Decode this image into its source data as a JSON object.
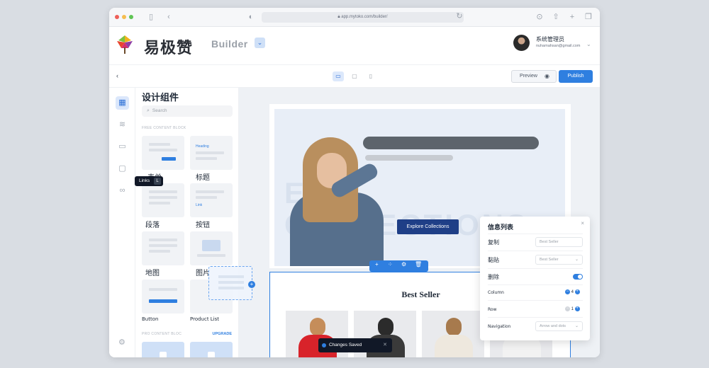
{
  "browser": {
    "url": "app.mytoko.com/builder/",
    "traffic_colors": [
      "#ee5f58",
      "#f5bd4f",
      "#5fc454"
    ]
  },
  "header": {
    "brand": "易极赞",
    "builder": "Builder",
    "user_name": "系统管理员",
    "user_email": "nuhamahsan@gmail.com"
  },
  "toolbar": {
    "preview_label": "Preview",
    "publish_label": "Publish"
  },
  "rail": {
    "tooltip_label": "Links",
    "tooltip_key": "L"
  },
  "panel": {
    "title": "设计组件",
    "search_placeholder": "Search",
    "free_label": "FREE CONTENT BLOCK",
    "pro_label": "PRO CONTENT BLOC",
    "upgrade_label": "UPGRADE",
    "tiles": [
      {
        "label": "表单",
        "thumb_text": ""
      },
      {
        "label": "标题",
        "thumb_text": "Heading"
      },
      {
        "label": "段落",
        "thumb_text": ""
      },
      {
        "label": "按钮",
        "thumb_text": "Link"
      },
      {
        "label": "地图",
        "thumb_text": ""
      },
      {
        "label": "图片",
        "thumb_text": ""
      },
      {
        "label": "Button",
        "thumb_text": ""
      },
      {
        "label": "Product List",
        "thumb_text": ""
      }
    ]
  },
  "canvas": {
    "hero_faint_1": "EXPL",
    "hero_faint_2": "COLLECTIONS",
    "explore_label": "Explore Collections",
    "bestseller_title": "Best Seller",
    "accent": "#2f7fe0"
  },
  "info_panel": {
    "title": "信息列表",
    "rows": [
      {
        "label": "复制",
        "value": "Best Seller"
      },
      {
        "label": "黏贴",
        "value": "Best Seller"
      },
      {
        "label": "删除",
        "value": ""
      }
    ],
    "column_label": "Column",
    "column_value": "4",
    "row_label": "Row",
    "row_value": "1",
    "navigation_label": "Navigation",
    "navigation_value": "Arrow and dots",
    "delete_toggle_on": true
  },
  "toast": {
    "text": "Changes Saved"
  }
}
